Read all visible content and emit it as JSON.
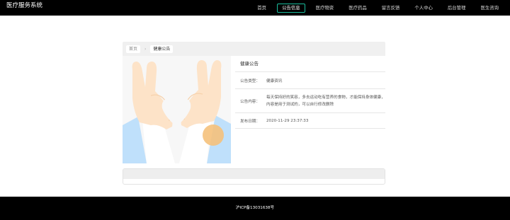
{
  "header": {
    "brand": "医疗服务系统",
    "nav": [
      "首页",
      "公告信息",
      "医疗物资",
      "医疗药品",
      "留言反馈",
      "个人中心",
      "后台管理",
      "医生咨询"
    ]
  },
  "breadcrumb": {
    "home": "首页",
    "separator": "›",
    "current": "健康公告"
  },
  "notice": {
    "title": "健康公告",
    "type_label": "公告类型：",
    "type_value": "健康资讯",
    "content_label": "公告内容：",
    "content_line1": "每天保持好的笑容，多去运动吃有营养的食物，才能保持身体健康，",
    "content_line2": "内容是用于测试的，可以自行修改删除",
    "date_label": "发布日期：",
    "date_value": "2020-11-29 23:37:33"
  },
  "footer": {
    "icp": "沪ICP备13031638号"
  },
  "colors": {
    "nav_active_border": "#1abc9c",
    "accent_circle": "#f5c17b"
  }
}
